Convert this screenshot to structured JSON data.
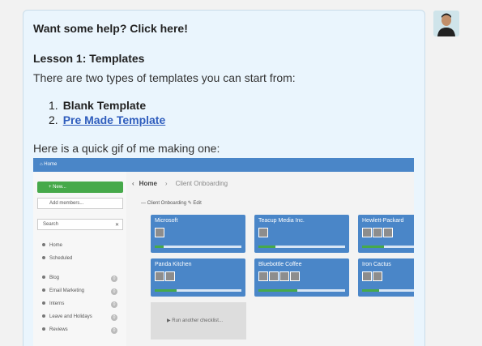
{
  "message": {
    "help_link": "Want some help? Click here!",
    "lesson_title": "Lesson 1: Templates",
    "intro": "There are two types of templates you can start from:",
    "items": [
      {
        "num": "1.",
        "label": "Blank Template"
      },
      {
        "num": "2.",
        "label": "Pre Made Template"
      }
    ],
    "gif_caption": "Here is a quick gif of me making one:"
  },
  "gif": {
    "topbar_home": "⌂ Home",
    "new_button": "+ New...",
    "add_members": "Add members...",
    "search_placeholder": "Search",
    "search_clear": "✕",
    "nav": [
      {
        "label": "Home",
        "count": ""
      },
      {
        "label": "Scheduled",
        "count": ""
      },
      {
        "label": "Blog",
        "count": "0"
      },
      {
        "label": "Email Marketing",
        "count": "0"
      },
      {
        "label": "Interns",
        "count": "0"
      },
      {
        "label": "Leave and Holidays",
        "count": "0"
      },
      {
        "label": "Reviews",
        "count": "0"
      }
    ],
    "crumb_home": "Home",
    "crumb_page": "Client Onboarding",
    "list_title": "Client Onboarding",
    "list_edit": "Edit",
    "cards": [
      {
        "name": "Microsoft",
        "progress": 0.1
      },
      {
        "name": "Teacup Media Inc.",
        "progress": 0.2
      },
      {
        "name": "Hewlett-Packard",
        "progress": 0.25
      },
      {
        "name": "Panda Kitchen",
        "progress": 0.25
      },
      {
        "name": "Bluebottle Coffee",
        "progress": 0.45
      },
      {
        "name": "Iron Cactus",
        "progress": 0.2
      }
    ],
    "run_checklist": "▶  Run another checklist..."
  },
  "colors": {
    "accent": "#4a86c8",
    "green": "#46a94a",
    "link": "#2f5dbd"
  }
}
